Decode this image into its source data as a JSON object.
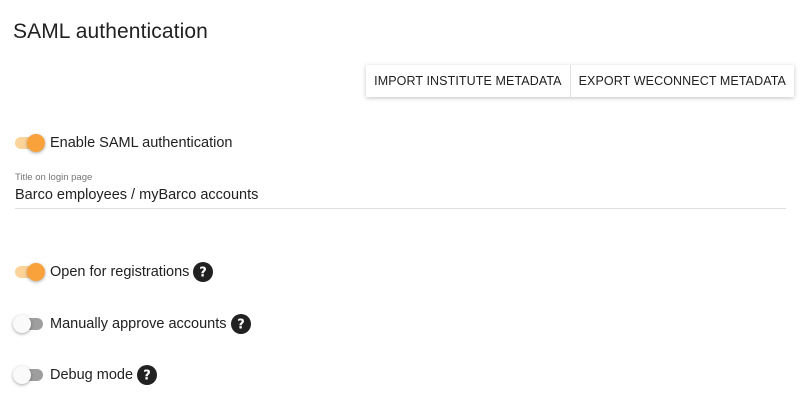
{
  "header": {
    "title": "SAML authentication"
  },
  "actions": {
    "import_label": "IMPORT INSTITUTE METADATA",
    "export_label": "EXPORT WECONNECT METADATA"
  },
  "settings": {
    "enable_saml": {
      "label": "Enable SAML authentication",
      "enabled": true
    },
    "login_title": {
      "label": "Title on login page",
      "value": "Barco employees / myBarco accounts"
    },
    "open_registrations": {
      "label": "Open for registrations",
      "enabled": true,
      "help_icon": "help-circle-icon"
    },
    "manual_approve": {
      "label": "Manually approve accounts",
      "enabled": false,
      "help_icon": "help-circle-icon"
    },
    "debug_mode": {
      "label": "Debug mode",
      "enabled": false,
      "help_icon": "help-circle-icon"
    }
  },
  "colors": {
    "accent": "#f9a23c",
    "accent_track": "#fcd39a",
    "off_track": "#9e9e9e",
    "help_icon": "#212121"
  }
}
